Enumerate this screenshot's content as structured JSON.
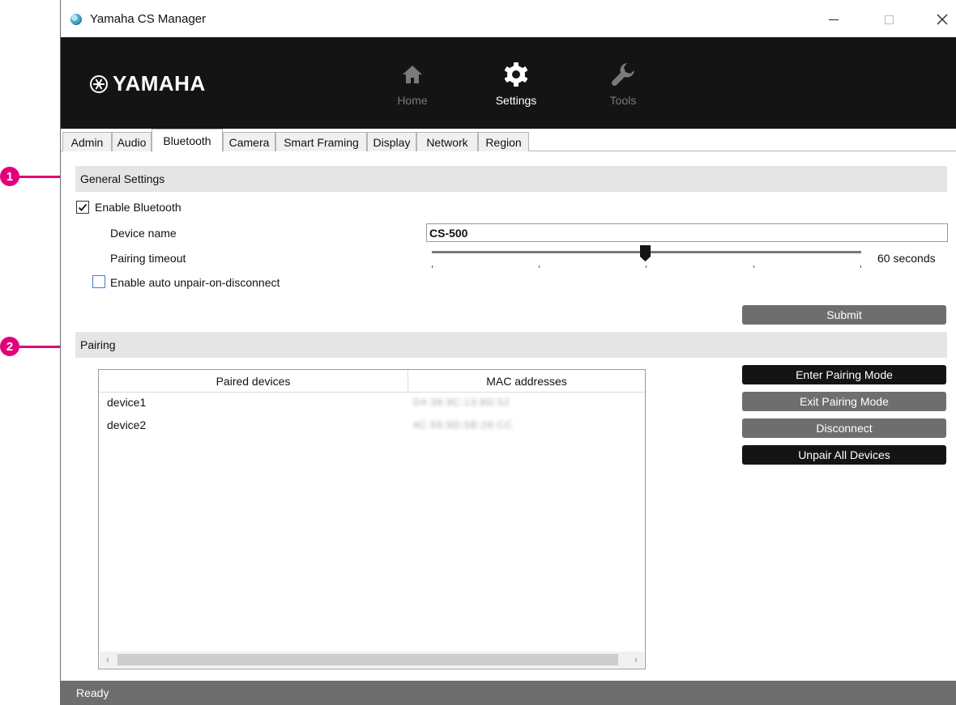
{
  "window": {
    "title": "Yamaha CS Manager"
  },
  "header": {
    "logo": "YAMAHA",
    "nav": [
      {
        "label": "Home",
        "icon": "home-icon",
        "state": "inactive"
      },
      {
        "label": "Settings",
        "icon": "gear-icon",
        "state": "active"
      },
      {
        "label": "Tools",
        "icon": "wrench-icon",
        "state": "inactive"
      }
    ]
  },
  "tabs": [
    {
      "label": "Admin"
    },
    {
      "label": "Audio"
    },
    {
      "label": "Bluetooth",
      "active": true
    },
    {
      "label": "Camera"
    },
    {
      "label": "Smart Framing"
    },
    {
      "label": "Display"
    },
    {
      "label": "Network"
    },
    {
      "label": "Region"
    }
  ],
  "callouts": [
    "1",
    "2"
  ],
  "general": {
    "header": "General Settings",
    "enable_bluetooth": {
      "label": "Enable Bluetooth",
      "checked": true
    },
    "device_name": {
      "label": "Device name",
      "value": "CS-500"
    },
    "pairing_timeout": {
      "label": "Pairing timeout",
      "value_text": "60 seconds",
      "level_fraction": 0.5
    },
    "auto_unpair": {
      "label": "Enable auto unpair-on-disconnect",
      "checked": false
    },
    "submit": "Submit"
  },
  "pairing": {
    "header": "Pairing",
    "columns": [
      "Paired devices",
      "MAC addresses"
    ],
    "rows": [
      {
        "device": "device1",
        "mac": "D4:38:9C:13:8D:52"
      },
      {
        "device": "device2",
        "mac": "4C:56:9D:5B:26:CC"
      }
    ],
    "buttons": {
      "enter": "Enter Pairing Mode",
      "exit": "Exit Pairing Mode",
      "disconnect": "Disconnect",
      "unpair_all": "Unpair All Devices"
    }
  },
  "status": "Ready",
  "colors": {
    "accent_magenta": "#e2007a",
    "header_bg": "#141414",
    "button_dark": "#141414",
    "button_grey": "#6e6e6e",
    "statusbar": "#6e6e6e",
    "section_header": "#e5e5e5"
  }
}
